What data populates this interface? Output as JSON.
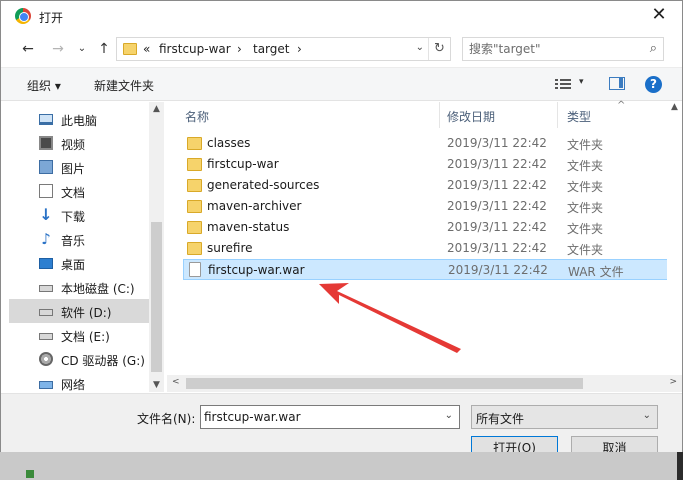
{
  "window": {
    "title": "打开",
    "close_glyph": "✕"
  },
  "nav_buttons": {
    "back": "←",
    "forward": "→",
    "recent": "⌄",
    "up": "↑"
  },
  "address": {
    "overflow": "«",
    "segments": [
      "firstcup-war",
      "target"
    ],
    "sep": "›",
    "dropdown": "⌄",
    "refresh": "↻"
  },
  "search": {
    "placeholder": "搜索\"target\"",
    "icon": "⌕"
  },
  "toolbar": {
    "organize": "组织 ▾",
    "new_folder": "新建文件夹",
    "view_dd": "▾",
    "help": "?"
  },
  "sidebar": {
    "items": [
      {
        "label": "此电脑",
        "icon": "pc"
      },
      {
        "label": "视频",
        "icon": "video"
      },
      {
        "label": "图片",
        "icon": "pic"
      },
      {
        "label": "文档",
        "icon": "doc"
      },
      {
        "label": "下载",
        "icon": "down",
        "glyph": "↓"
      },
      {
        "label": "音乐",
        "icon": "music",
        "glyph": "♪"
      },
      {
        "label": "桌面",
        "icon": "desk"
      },
      {
        "label": "本地磁盘 (C:)",
        "icon": "drive"
      },
      {
        "label": "软件 (D:)",
        "icon": "drive",
        "selected": true
      },
      {
        "label": "文档 (E:)",
        "icon": "drive"
      },
      {
        "label": "CD 驱动器 (G:)",
        "icon": "cd"
      },
      {
        "label": "网络",
        "icon": "net"
      }
    ],
    "scroll_up": "▲",
    "scroll_down": "▼"
  },
  "columns": {
    "name": "名称",
    "date": "修改日期",
    "type": "类型",
    "sort": "^"
  },
  "files": [
    {
      "name": "classes",
      "date": "2019/3/11 22:42",
      "type": "文件夹",
      "kind": "folder"
    },
    {
      "name": "firstcup-war",
      "date": "2019/3/11 22:42",
      "type": "文件夹",
      "kind": "folder"
    },
    {
      "name": "generated-sources",
      "date": "2019/3/11 22:42",
      "type": "文件夹",
      "kind": "folder"
    },
    {
      "name": "maven-archiver",
      "date": "2019/3/11 22:42",
      "type": "文件夹",
      "kind": "folder"
    },
    {
      "name": "maven-status",
      "date": "2019/3/11 22:42",
      "type": "文件夹",
      "kind": "folder"
    },
    {
      "name": "surefire",
      "date": "2019/3/11 22:42",
      "type": "文件夹",
      "kind": "folder"
    },
    {
      "name": "firstcup-war.war",
      "date": "2019/3/11 22:42",
      "type": "WAR 文件",
      "kind": "file",
      "selected": true
    }
  ],
  "hscroll": {
    "left": "<",
    "right": ">"
  },
  "footer": {
    "filename_label": "文件名(N):",
    "filename_value": "firstcup-war.war",
    "filter_value": "所有文件",
    "dropdown": "⌄",
    "open_button": "打开(O)",
    "cancel_button": "取消"
  },
  "annotation": {
    "arrow_color": "#e53935"
  }
}
